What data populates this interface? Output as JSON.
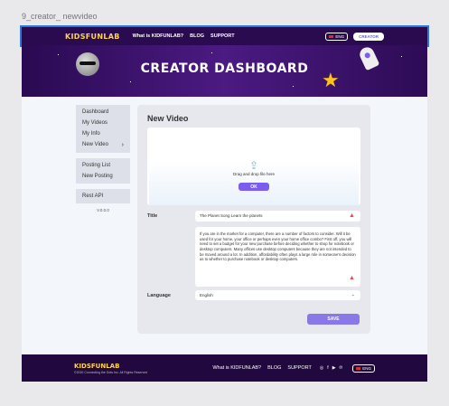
{
  "frame": {
    "label": "9_creator_ newvideo"
  },
  "navbar": {
    "logo": "KIDSFUNLAB",
    "links": [
      "What is KIDFUNLAB?",
      "BLOG",
      "SUPPORT"
    ],
    "lang_label": "ENG",
    "creator_label": "CREATOR"
  },
  "hero": {
    "title": "CREATOR DASHBOARD"
  },
  "sidebar": {
    "group1": [
      "Dashboard",
      "My Videos",
      "My Info",
      "New Video"
    ],
    "group2": [
      "Posting List",
      "New Posting"
    ],
    "group3": [
      "Rest API"
    ],
    "version": "V.0.0.0"
  },
  "main": {
    "title": "New Video",
    "upload": {
      "text": "Drag and drop file here",
      "ok_label": "OK"
    },
    "title_label": "Title",
    "title_value": "The Planet Song Learn the planets",
    "description_value": "If you are in the market for a computer, there are a number of factors to consider. Will it be used for your home, your office or perhaps even your home office combo? First off, you will need to set a budget for your new purchase before deciding whether to shop for notebook or desktop computers. Many offices use desktop computers because they are not intended to be moved around a lot. In addition, affordability often plays a large role in someone's decision as to whether to purchase notebook or desktop computers.",
    "language_label": "Language",
    "language_value": "English",
    "save_label": "SAVE"
  },
  "footer": {
    "logo": "KIDSFUNLAB",
    "copyright": "©2020 Connecting the Dots Inc. All Rights Reserved",
    "links": [
      "What is KIDFUNLAB?",
      "BLOG",
      "SUPPORT"
    ],
    "social_icons": [
      "instagram-icon",
      "facebook-icon",
      "youtube-icon",
      "pinterest-icon"
    ],
    "lang_label": "ENG"
  },
  "colors": {
    "nav_bg": "#2a0b4f",
    "accent": "#7a5cf0",
    "logo_yellow": "#ffd34d",
    "warning": "#e94b4b"
  }
}
